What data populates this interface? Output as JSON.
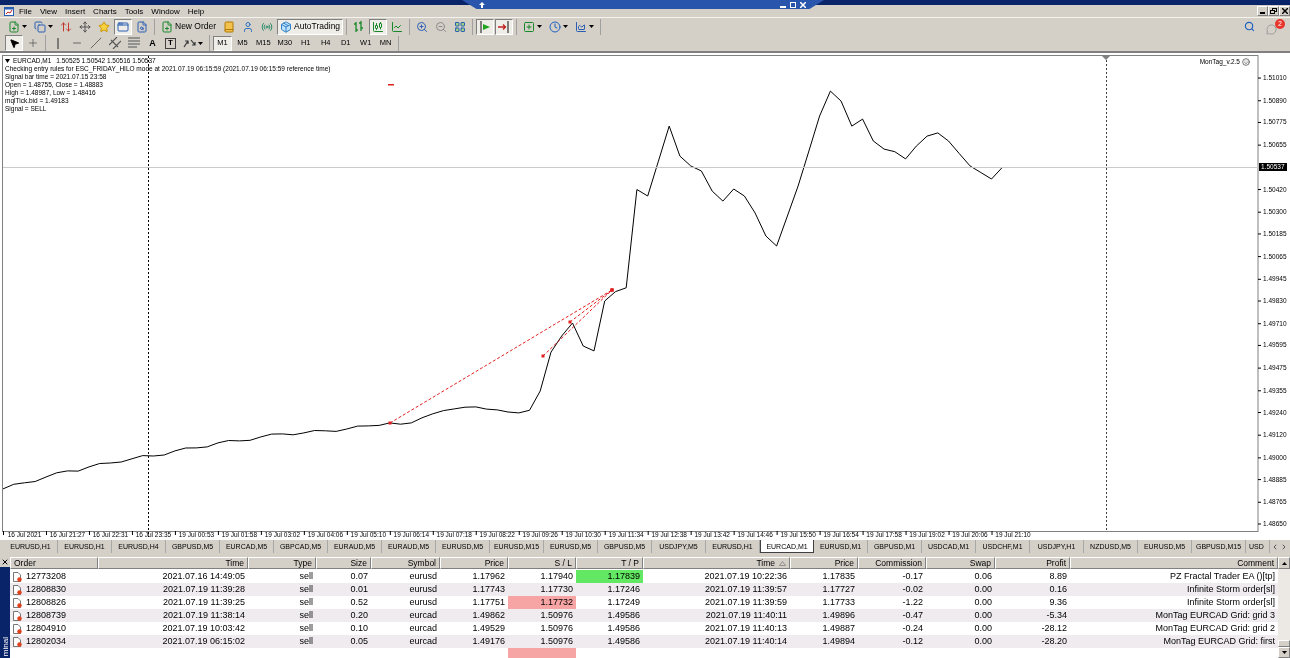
{
  "menu": [
    "File",
    "View",
    "Insert",
    "Charts",
    "Tools",
    "Window",
    "Help"
  ],
  "toolbar": {
    "groups": [
      [
        {
          "kind": "newchart",
          "pressed": false
        },
        {
          "kind": "profiles",
          "pressed": false
        },
        {
          "kind": "marketwatch",
          "pressed": false
        },
        {
          "kind": "navigator",
          "pressed": false
        },
        {
          "kind": "favorites",
          "pressed": false
        },
        {
          "kind": "terminal",
          "pressed": true
        },
        {
          "kind": "tester",
          "pressed": false
        }
      ],
      [
        {
          "kind": "neworder",
          "label": "New Order",
          "pressed": false
        },
        {
          "kind": "editor",
          "pressed": false
        },
        {
          "kind": "account",
          "pressed": false
        },
        {
          "kind": "signals",
          "pressed": false
        },
        {
          "kind": "autotrading",
          "label": "AutoTrading",
          "pressed": true
        }
      ],
      [
        {
          "kind": "bars",
          "pressed": false
        },
        {
          "kind": "candles",
          "pressed": true
        },
        {
          "kind": "line",
          "pressed": false
        }
      ],
      [
        {
          "kind": "zoomin",
          "pressed": false
        },
        {
          "kind": "zoomout",
          "pressed": false
        },
        {
          "kind": "tile",
          "pressed": false
        }
      ],
      [
        {
          "kind": "autoscroll",
          "pressed": true
        },
        {
          "kind": "shift",
          "pressed": true
        }
      ],
      [
        {
          "kind": "indicators",
          "pressed": false
        },
        {
          "kind": "periods",
          "pressed": false
        },
        {
          "kind": "templates",
          "pressed": false
        }
      ]
    ],
    "notifications": "2"
  },
  "drawing_toolbar": {
    "groups": [
      [
        {
          "kind": "cursor",
          "pressed": true
        },
        {
          "kind": "crosshair",
          "pressed": false
        }
      ],
      [
        {
          "kind": "vline",
          "pressed": false
        },
        {
          "kind": "hline",
          "pressed": false
        },
        {
          "kind": "trendline",
          "pressed": false
        },
        {
          "kind": "channel",
          "pressed": false
        },
        {
          "kind": "fibonacci",
          "pressed": false
        },
        {
          "kind": "text",
          "label": "A",
          "pressed": false
        },
        {
          "kind": "label",
          "label": "T",
          "pressed": false
        },
        {
          "kind": "shapes",
          "pressed": false
        }
      ]
    ],
    "timeframes": [
      {
        "label": "M1",
        "selected": true
      },
      {
        "label": "M5",
        "selected": false
      },
      {
        "label": "M15",
        "selected": false
      },
      {
        "label": "M30",
        "selected": false
      },
      {
        "label": "H1",
        "selected": false
      },
      {
        "label": "H4",
        "selected": false
      },
      {
        "label": "D1",
        "selected": false
      },
      {
        "label": "W1",
        "selected": false
      },
      {
        "label": "MN",
        "selected": false
      }
    ]
  },
  "chart": {
    "symbol": "EURCAD,M1",
    "ohlc": "1.50525 1.50542 1.50516 1.50537",
    "comment": [
      "Checking entry rules for ESC_FRIDAY_HILO mode at 2021.07.19 06:15:59 (2021.07.19 06:15:59 reference time)",
      "Signal bar time = 2021.07.15 23:58",
      "Open = 1.48755, Close = 1.48883",
      "High = 1.48987, Low = 1.48416",
      "mqlTick.bid = 1.49183",
      "Signal = SELL"
    ],
    "indicator": "MonTag_v.2.5",
    "current_price": "1.50537",
    "chart_data": {
      "type": "line",
      "categories": [
        null,
        null,
        "16 Jul 2021",
        null,
        null,
        null,
        "16 Jul 21:27",
        null,
        null,
        null,
        "16 Jul 22:31",
        null,
        null,
        null,
        "16 Jul 23:35",
        null,
        null,
        null,
        "19 Jul 00:53",
        null,
        null,
        null,
        "19 Jul 01:58",
        null,
        null,
        null,
        "19 Jul 03:02",
        null,
        null,
        null,
        "19 Jul 04:06",
        null,
        null,
        null,
        "19 Jul 05:10",
        null,
        null,
        null,
        "19 Jul 06:14",
        null,
        null,
        null,
        "19 Jul 07:18",
        null,
        null,
        null,
        "19 Jul 08:22",
        null,
        null,
        null,
        "19 Jul 09:26",
        null,
        null,
        null,
        "19 Jul 10:30",
        null,
        null,
        null,
        "19 Jul 11:34",
        null,
        null,
        null,
        "19 Jul 12:38",
        null,
        null,
        null,
        "19 Jul 13:42",
        null,
        null,
        null,
        "19 Jul 14:46",
        null,
        null,
        null,
        "19 Jul 15:50",
        null,
        null,
        null,
        "19 Jul 16:54",
        null,
        null,
        null,
        "19 Jul 17:58",
        null,
        null,
        null,
        "19 Jul 19:02",
        null,
        null,
        null,
        "19 Jul 20:06",
        null,
        null,
        null,
        "19 Jul 21:10",
        null,
        null,
        null,
        null,
        null,
        null,
        null,
        null,
        null,
        null,
        null,
        null,
        null,
        null,
        null,
        null,
        null,
        null,
        null,
        null,
        null,
        null
      ],
      "values": [
        1.48836,
        1.4886,
        1.48868,
        1.48875,
        1.48899,
        1.48921,
        1.48931,
        1.4893,
        1.48952,
        1.4897,
        1.48973,
        1.48978,
        1.48995,
        1.49012,
        1.4901,
        1.49015,
        1.49037,
        1.49052,
        1.49053,
        1.49058,
        1.49079,
        1.49092,
        1.4909,
        1.49093,
        1.49111,
        1.49126,
        1.49127,
        1.49122,
        1.49132,
        1.49145,
        1.49143,
        1.4914,
        1.49153,
        1.49168,
        1.49169,
        1.49172,
        1.49185,
        1.49178,
        1.49185,
        1.49212,
        1.49233,
        1.4925,
        1.49259,
        1.49268,
        1.4927,
        1.49258,
        1.49254,
        1.49243,
        1.49238,
        1.49252,
        1.49354,
        1.4956,
        1.49645,
        1.49714,
        1.49592,
        1.49566,
        1.4983,
        1.4988,
        1.499,
        1.5042,
        1.50386,
        1.5057,
        1.50756,
        1.50597,
        1.50545,
        1.50518,
        1.50412,
        1.50359,
        1.50423,
        1.50386,
        1.50296,
        1.50174,
        1.50121,
        1.5028,
        1.50439,
        1.50624,
        1.50809,
        1.50941,
        1.50888,
        1.50756,
        1.50793,
        1.50677,
        1.50634,
        1.5062,
        1.50582,
        1.5065,
        1.50703,
        1.5072,
        1.50677,
        1.5061,
        1.50545,
        1.5051,
        1.50476,
        1.50537,
        null,
        null,
        null,
        null,
        null,
        null,
        null,
        null,
        null,
        null,
        null,
        null,
        null,
        null,
        null,
        null,
        null,
        null,
        null,
        null,
        null,
        null,
        null
      ],
      "ylim": [
        1.48613,
        1.51132
      ],
      "yticks": [
        {
          "value": 1.5101,
          "label": "1.51010"
        },
        {
          "value": 1.5089,
          "label": "1.50890"
        },
        {
          "value": 1.50775,
          "label": "1.50775"
        },
        {
          "value": 1.50655,
          "label": "1.50655"
        },
        {
          "value": 1.5042,
          "label": "1.50420"
        },
        {
          "value": 1.503,
          "label": "1.50300"
        },
        {
          "value": 1.50185,
          "label": "1.50185"
        },
        {
          "value": 1.50065,
          "label": "1.50065"
        },
        {
          "value": 1.49945,
          "label": "1.49945"
        },
        {
          "value": 1.4983,
          "label": "1.49830"
        },
        {
          "value": 1.4971,
          "label": "1.49710"
        },
        {
          "value": 1.49595,
          "label": "1.49595"
        },
        {
          "value": 1.49475,
          "label": "1.49475"
        },
        {
          "value": 1.49355,
          "label": "1.49355"
        },
        {
          "value": 1.4924,
          "label": "1.49240"
        },
        {
          "value": 1.4912,
          "label": "1.49120"
        },
        {
          "value": 1.49,
          "label": "1.49000"
        },
        {
          "value": 1.48885,
          "label": "1.48885"
        },
        {
          "value": 1.48765,
          "label": "1.48765"
        },
        {
          "value": 1.4865,
          "label": "1.48650"
        }
      ]
    }
  },
  "chart_tabs": [
    {
      "label": "EURUSD,H1",
      "selected": false
    },
    {
      "label": "EURUSD,H1",
      "selected": false
    },
    {
      "label": "EURUSD,H4",
      "selected": false
    },
    {
      "label": "GBPUSD,M5",
      "selected": false
    },
    {
      "label": "EURCAD,M5",
      "selected": false
    },
    {
      "label": "GBPCAD,M5",
      "selected": false
    },
    {
      "label": "EURAUD,M5",
      "selected": false
    },
    {
      "label": "EURAUD,M5",
      "selected": false
    },
    {
      "label": "EURUSD,M5",
      "selected": false
    },
    {
      "label": "EURUSD,M15",
      "selected": false
    },
    {
      "label": "EURUSD,M5",
      "selected": false
    },
    {
      "label": "GBPUSD,M5",
      "selected": false
    },
    {
      "label": "USDJPY,M5",
      "selected": false
    },
    {
      "label": "EURUSD,H1",
      "selected": false
    },
    {
      "label": "EURCAD,M1",
      "selected": true
    },
    {
      "label": "EURUSD,M1",
      "selected": false
    },
    {
      "label": "GBPUSD,M1",
      "selected": false
    },
    {
      "label": "USDCAD,M1",
      "selected": false
    },
    {
      "label": "USDCHF,M1",
      "selected": false
    },
    {
      "label": "USDJPY,H1",
      "selected": false
    },
    {
      "label": "NZDUSD,M5",
      "selected": false
    },
    {
      "label": "EURUSD,M5",
      "selected": false
    },
    {
      "label": "GBPUSD,M15",
      "selected": false
    },
    {
      "label": "USD",
      "selected": false
    }
  ],
  "terminal": {
    "title": "minal",
    "columns": [
      {
        "label": "Order",
        "sorted": false
      },
      {
        "label": "Time",
        "sorted": false
      },
      {
        "label": "Type",
        "sorted": false
      },
      {
        "label": "Size",
        "sorted": false
      },
      {
        "label": "Symbol",
        "sorted": false
      },
      {
        "label": "Price",
        "sorted": false
      },
      {
        "label": "S / L",
        "sorted": false
      },
      {
        "label": "T / P",
        "sorted": false
      },
      {
        "label": "Time",
        "sorted": true
      },
      {
        "label": "Price",
        "sorted": false
      },
      {
        "label": "Commission",
        "sorted": false
      },
      {
        "label": "Swap",
        "sorted": false
      },
      {
        "label": "Profit",
        "sorted": false
      },
      {
        "label": "Comment",
        "sorted": false
      }
    ],
    "rows": [
      {
        "order": "12773208",
        "open_time": "2021.07.16 14:49:05",
        "type": "sell",
        "size": "0.07",
        "symbol": "eurusd",
        "open_price": "1.17962",
        "sl": "1.17940",
        "tp": "1.17839",
        "close_time": "2021.07.19 10:22:36",
        "close_price": "1.17835",
        "commission": "-0.17",
        "swap": "0.06",
        "profit": "8.89",
        "comment": "PZ Fractal Trader EA ()[tp]",
        "sl_hit": false,
        "tp_hit": true
      },
      {
        "order": "12808830",
        "open_time": "2021.07.19 11:39:28",
        "type": "sell",
        "size": "0.01",
        "symbol": "eurusd",
        "open_price": "1.17743",
        "sl": "1.17730",
        "tp": "1.17246",
        "close_time": "2021.07.19 11:39:57",
        "close_price": "1.17727",
        "commission": "-0.02",
        "swap": "0.00",
        "profit": "0.16",
        "comment": "Infinite Storm order[sl]",
        "sl_hit": false,
        "tp_hit": false
      },
      {
        "order": "12808826",
        "open_time": "2021.07.19 11:39:25",
        "type": "sell",
        "size": "0.52",
        "symbol": "eurusd",
        "open_price": "1.17751",
        "sl": "1.17732",
        "tp": "1.17249",
        "close_time": "2021.07.19 11:39:59",
        "close_price": "1.17733",
        "commission": "-1.22",
        "swap": "0.00",
        "profit": "9.36",
        "comment": "Infinite Storm order[sl]",
        "sl_hit": true,
        "tp_hit": false
      },
      {
        "order": "12808739",
        "open_time": "2021.07.19 11:38:14",
        "type": "sell",
        "size": "0.20",
        "symbol": "eurcad",
        "open_price": "1.49862",
        "sl": "1.50976",
        "tp": "1.49586",
        "close_time": "2021.07.19 11:40:11",
        "close_price": "1.49896",
        "commission": "-0.47",
        "swap": "0.00",
        "profit": "-5.34",
        "comment": "MonTag EURCAD Grid: grid 3",
        "sl_hit": false,
        "tp_hit": false
      },
      {
        "order": "12804910",
        "open_time": "2021.07.19 10:03:42",
        "type": "sell",
        "size": "0.10",
        "symbol": "eurcad",
        "open_price": "1.49529",
        "sl": "1.50976",
        "tp": "1.49586",
        "close_time": "2021.07.19 11:40:13",
        "close_price": "1.49887",
        "commission": "-0.24",
        "swap": "0.00",
        "profit": "-28.12",
        "comment": "MonTag EURCAD Grid: grid 2",
        "sl_hit": false,
        "tp_hit": false
      },
      {
        "order": "12802034",
        "open_time": "2021.07.19 06:15:02",
        "type": "sell",
        "size": "0.05",
        "symbol": "eurcad",
        "open_price": "1.49176",
        "sl": "1.50976",
        "tp": "1.49586",
        "close_time": "2021.07.19 11:40:14",
        "close_price": "1.49894",
        "commission": "-0.12",
        "swap": "0.00",
        "profit": "-28.20",
        "comment": "MonTag EURCAD Grid: first",
        "sl_hit": false,
        "tp_hit": false
      }
    ],
    "partial_row": {
      "sl_hit": true
    }
  }
}
